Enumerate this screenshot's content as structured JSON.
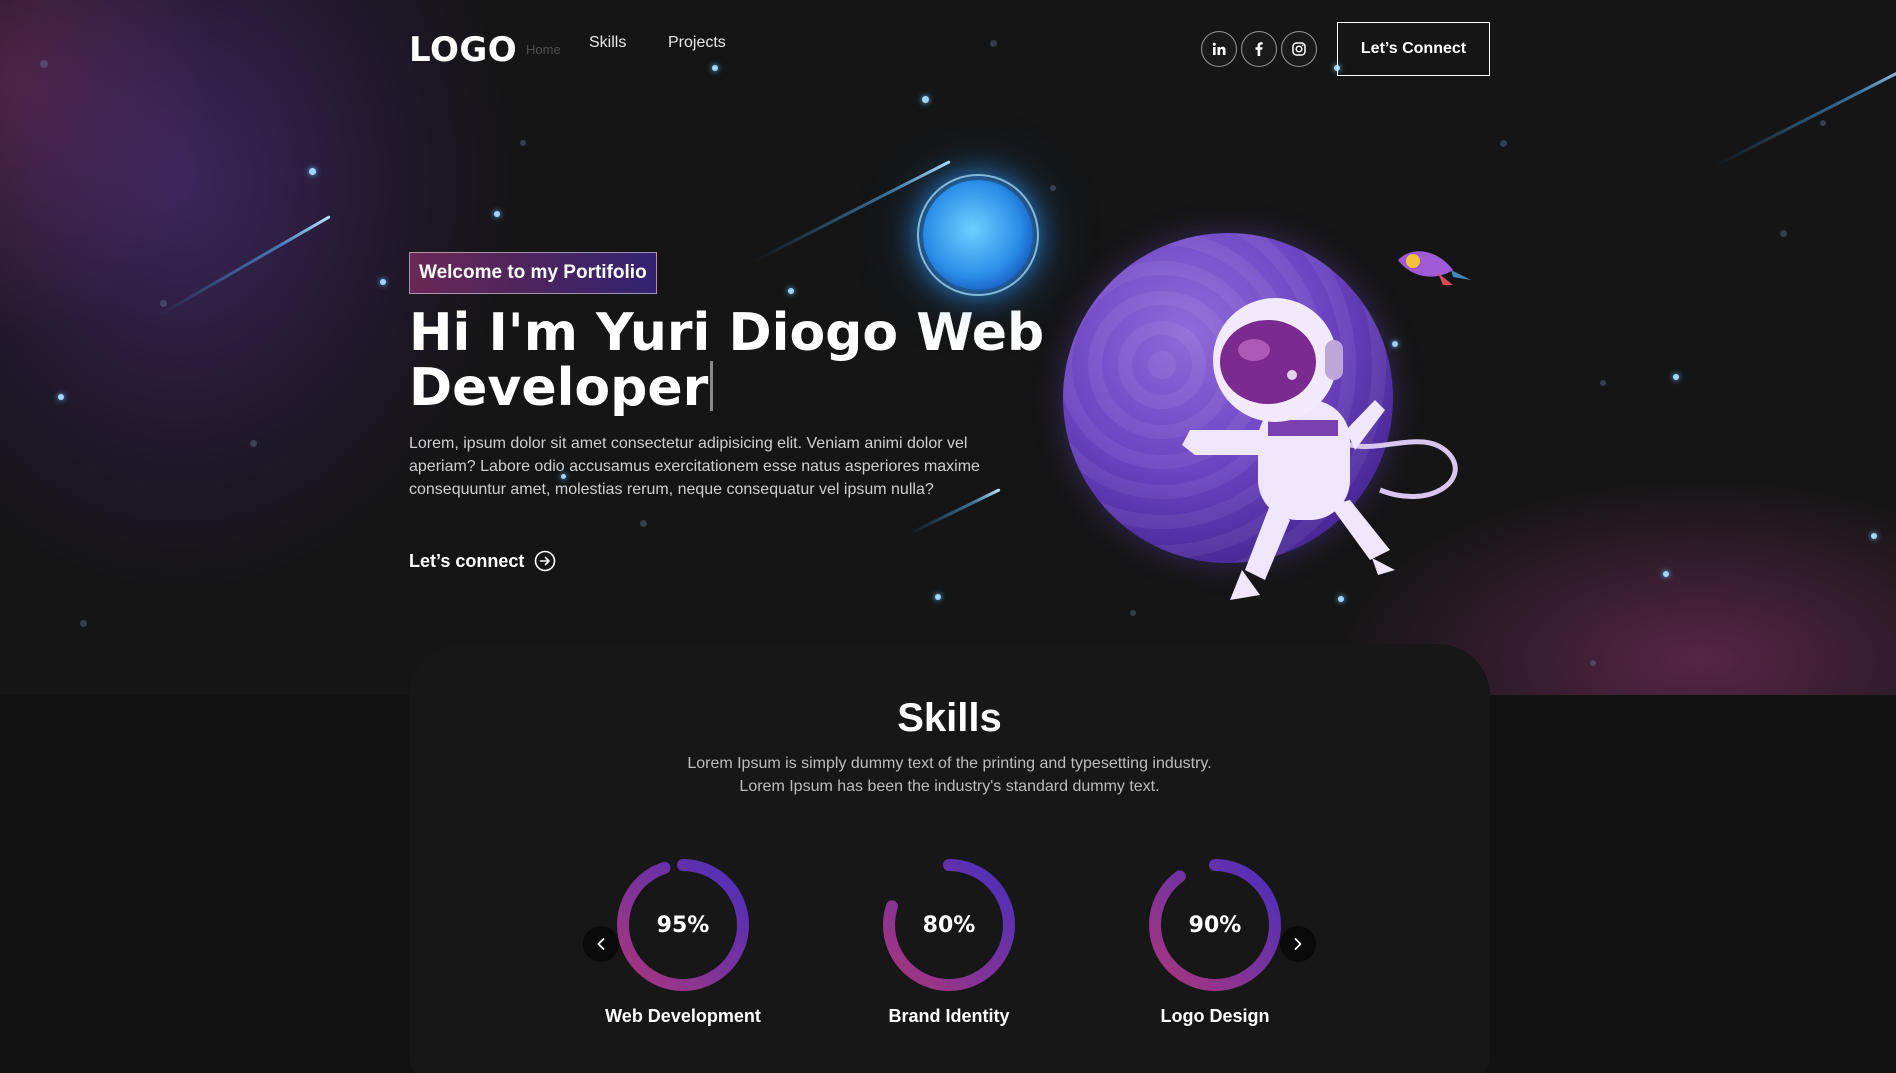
{
  "nav": {
    "logo": "LOGO",
    "links": [
      "Home",
      "Skills",
      "Projects"
    ],
    "social": [
      {
        "icon": "linkedin-icon",
        "label": "in"
      },
      {
        "icon": "facebook-icon",
        "label": "f"
      },
      {
        "icon": "instagram-icon",
        "label": ""
      }
    ],
    "connect_button": "Let’s Connect"
  },
  "hero": {
    "tagline": "Welcome to my Portifolio",
    "headline": "Hi I'm Yuri Diogo Web Developer",
    "intro": "Lorem, ipsum dolor sit amet consectetur adipisicing elit. Veniam animi dolor vel aperiam? Labore odio accusamus exercitationem esse natus asperiores maxime consequuntur amet, molestias rerum, neque consequatur vel ipsum nulla?",
    "cta": "Let’s connect",
    "cta_icon": "arrow-right-circle-icon"
  },
  "skills": {
    "title": "Skills",
    "description_line1": "Lorem Ipsum is simply dummy text of the printing and typesetting industry.",
    "description_line2": "Lorem Ipsum has been the industry's standard dummy text.",
    "items": [
      {
        "value_label": "95%",
        "percent": 95,
        "name": "Web Development"
      },
      {
        "value_label": "80%",
        "percent": 80,
        "name": "Brand Identity"
      },
      {
        "value_label": "90%",
        "percent": 90,
        "name": "Logo Design"
      }
    ],
    "prev_icon": "chevron-left-icon",
    "next_icon": "chevron-right-icon"
  },
  "colors": {
    "background": "#121212",
    "accent_pink": "#AA367C",
    "accent_purple": "#4A2FBD",
    "star_blue": "#9fd8ff"
  }
}
